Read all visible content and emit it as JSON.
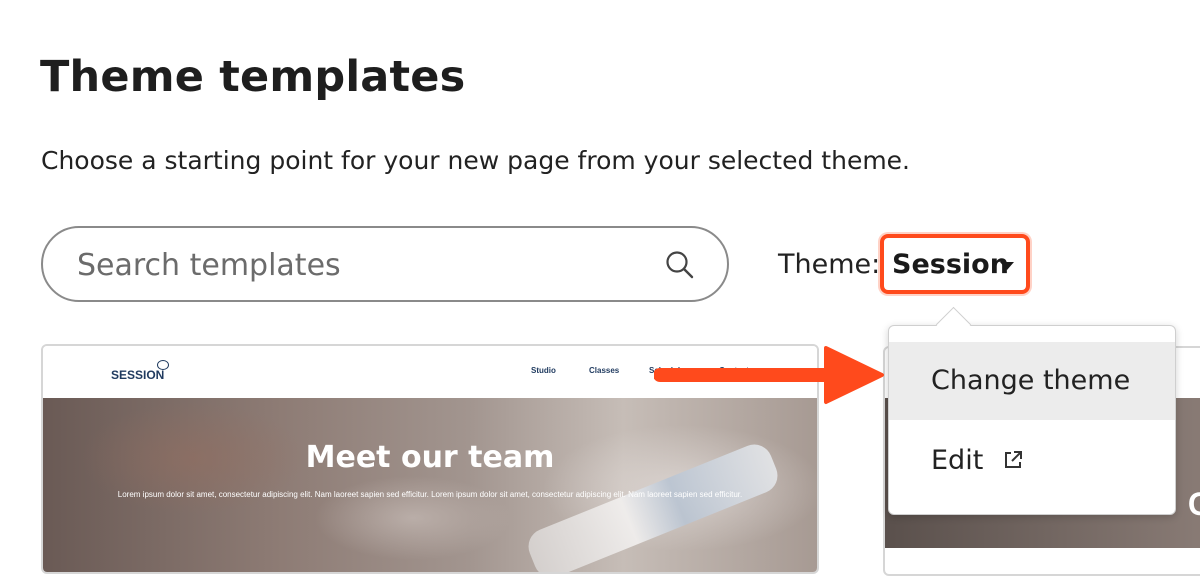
{
  "header": {
    "title": "Theme templates",
    "subtitle": "Choose a starting point for your new page from your selected theme."
  },
  "search": {
    "placeholder": "Search templates"
  },
  "theme": {
    "label": "Theme:",
    "selected": "Session",
    "highlight_color": "#ff4a1c"
  },
  "dropdown": {
    "items": [
      {
        "label": "Change theme"
      },
      {
        "label": "Edit"
      }
    ]
  },
  "template_card": {
    "logo": "SESSION",
    "nav": [
      "Studio",
      "Classes",
      "Schedule",
      "Contact"
    ],
    "hero_title": "Meet our team",
    "hero_text": "Lorem ipsum dolor sit amet, consectetur adipiscing elit. Nam laoreet sapien sed efficitur. Lorem ipsum dolor sit amet, consectetur adipiscing elit. Nam laoreet sapien sed efficitur."
  },
  "template_card_2": {
    "hero_letter": "C"
  },
  "annotation": {
    "arrow_color": "#ff4a1c"
  }
}
